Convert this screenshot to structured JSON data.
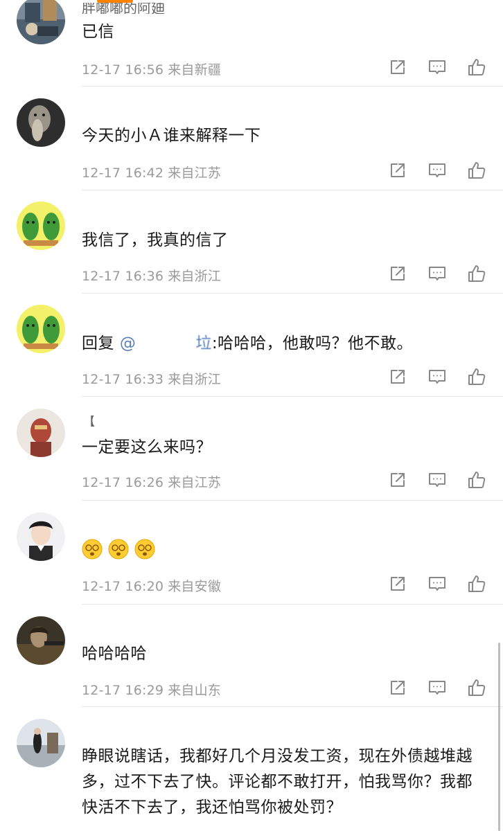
{
  "comments": [
    {
      "nickname": "胖嘟嘟的阿廸",
      "text": "已信",
      "time": "12-17 16:56",
      "location": "来自新疆"
    },
    {
      "nickname": "",
      "text": "今天的小Ａ谁来解释一下",
      "time": "12-17 16:42",
      "location": "来自江苏"
    },
    {
      "nickname": "",
      "text": "我信了，我真的信了",
      "time": "12-17 16:36",
      "location": "来自浙江"
    },
    {
      "nickname": "",
      "reply_prefix": "回复",
      "mention_at": "@",
      "mention_suffix": "垃",
      "text": ":哈哈哈，他敢吗？他不敢。",
      "time": "12-17 16:33",
      "location": "来自浙江"
    },
    {
      "nickname": "【",
      "text": "一定要这么来吗？",
      "time": "12-17 16:26",
      "location": "来自江苏"
    },
    {
      "nickname": "",
      "text": "",
      "emojis": [
        "dizzy-face-emoji",
        "dizzy-face-emoji",
        "dizzy-face-emoji"
      ],
      "time": "12-17 16:20",
      "location": "来自安徽"
    },
    {
      "nickname": "",
      "text": "哈哈哈哈",
      "time": "12-17 16:29",
      "location": "来自山东"
    },
    {
      "nickname": "",
      "text": "睁眼说瞎话，我都好几个月没发工资，现在外债越堆越多，过不下去了快。评论都不敢打开，怕我骂你？我都快活不下去了，我还怕骂你被处罚？",
      "time": "",
      "location": ""
    }
  ],
  "icons": {
    "share": "share-icon",
    "reply": "comment-icon",
    "like": "thumbs-up-icon"
  },
  "colors": {
    "accent": "#ff8200",
    "mention": "#5a7fbd",
    "meta": "#9a9a9a",
    "divider": "#e6e6e6"
  }
}
